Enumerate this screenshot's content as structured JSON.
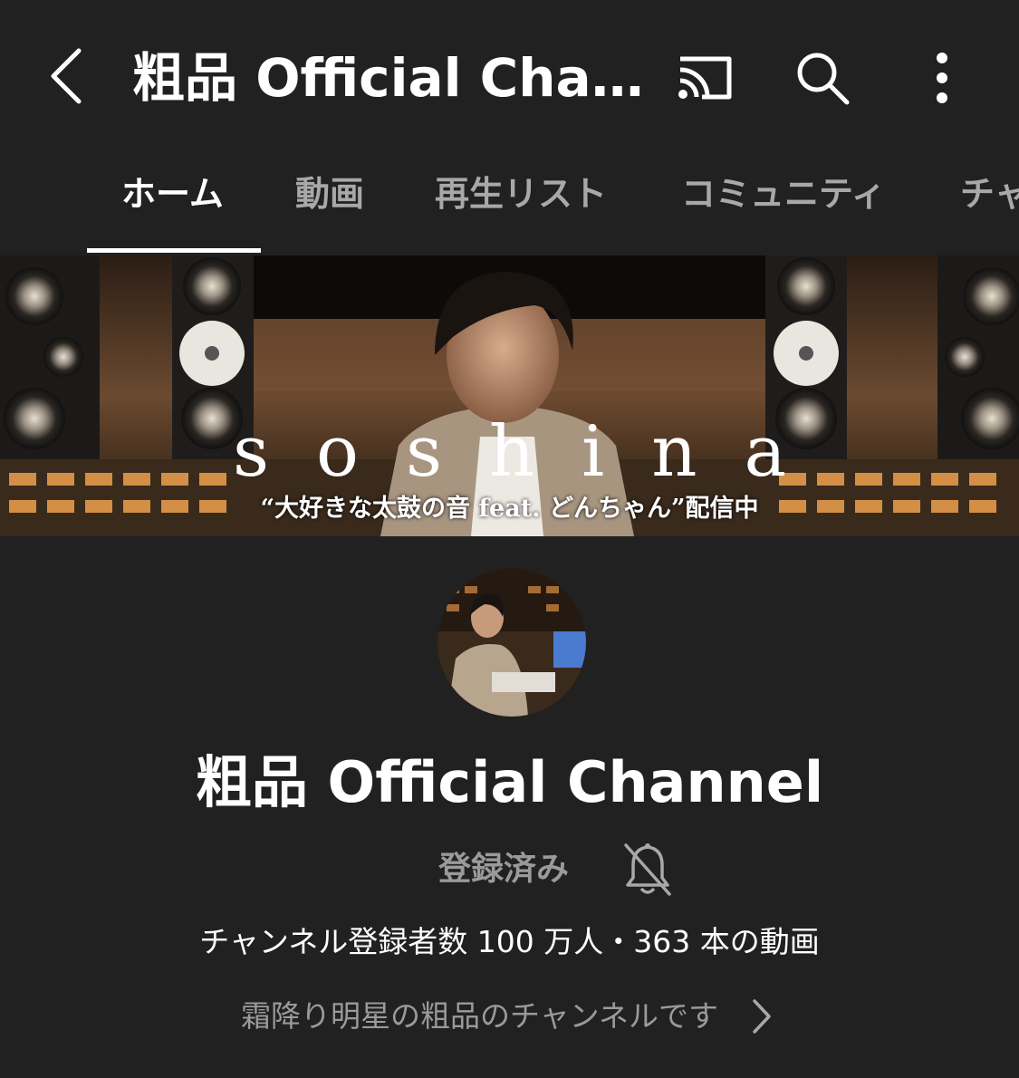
{
  "appbar": {
    "title": "粗品 Official Chan…",
    "back_icon": "chevron-left-icon",
    "cast_icon": "cast-icon",
    "search_icon": "search-icon",
    "more_icon": "more-vertical-icon"
  },
  "tabs": [
    {
      "label": "ホーム",
      "active": true
    },
    {
      "label": "動画",
      "active": false
    },
    {
      "label": "再生リスト",
      "active": false
    },
    {
      "label": "コミュニティ",
      "active": false
    },
    {
      "label": "チャ",
      "active": false
    }
  ],
  "banner": {
    "title": "soshina",
    "subtitle": "“大好きな太鼓の音 feat. どんちゃん”配信中"
  },
  "channel": {
    "name": "粗品 Official Channel",
    "subscribe_label": "登録済み",
    "bell_icon": "bell-off-icon",
    "stats": "チャンネル登録者数 100 万人・363 本の動画",
    "description": "霜降り明星の粗品のチャンネルです",
    "description_icon": "chevron-right-icon"
  },
  "colors": {
    "background": "#212121",
    "text_primary": "#ffffff",
    "text_secondary": "#a8a8a8"
  }
}
